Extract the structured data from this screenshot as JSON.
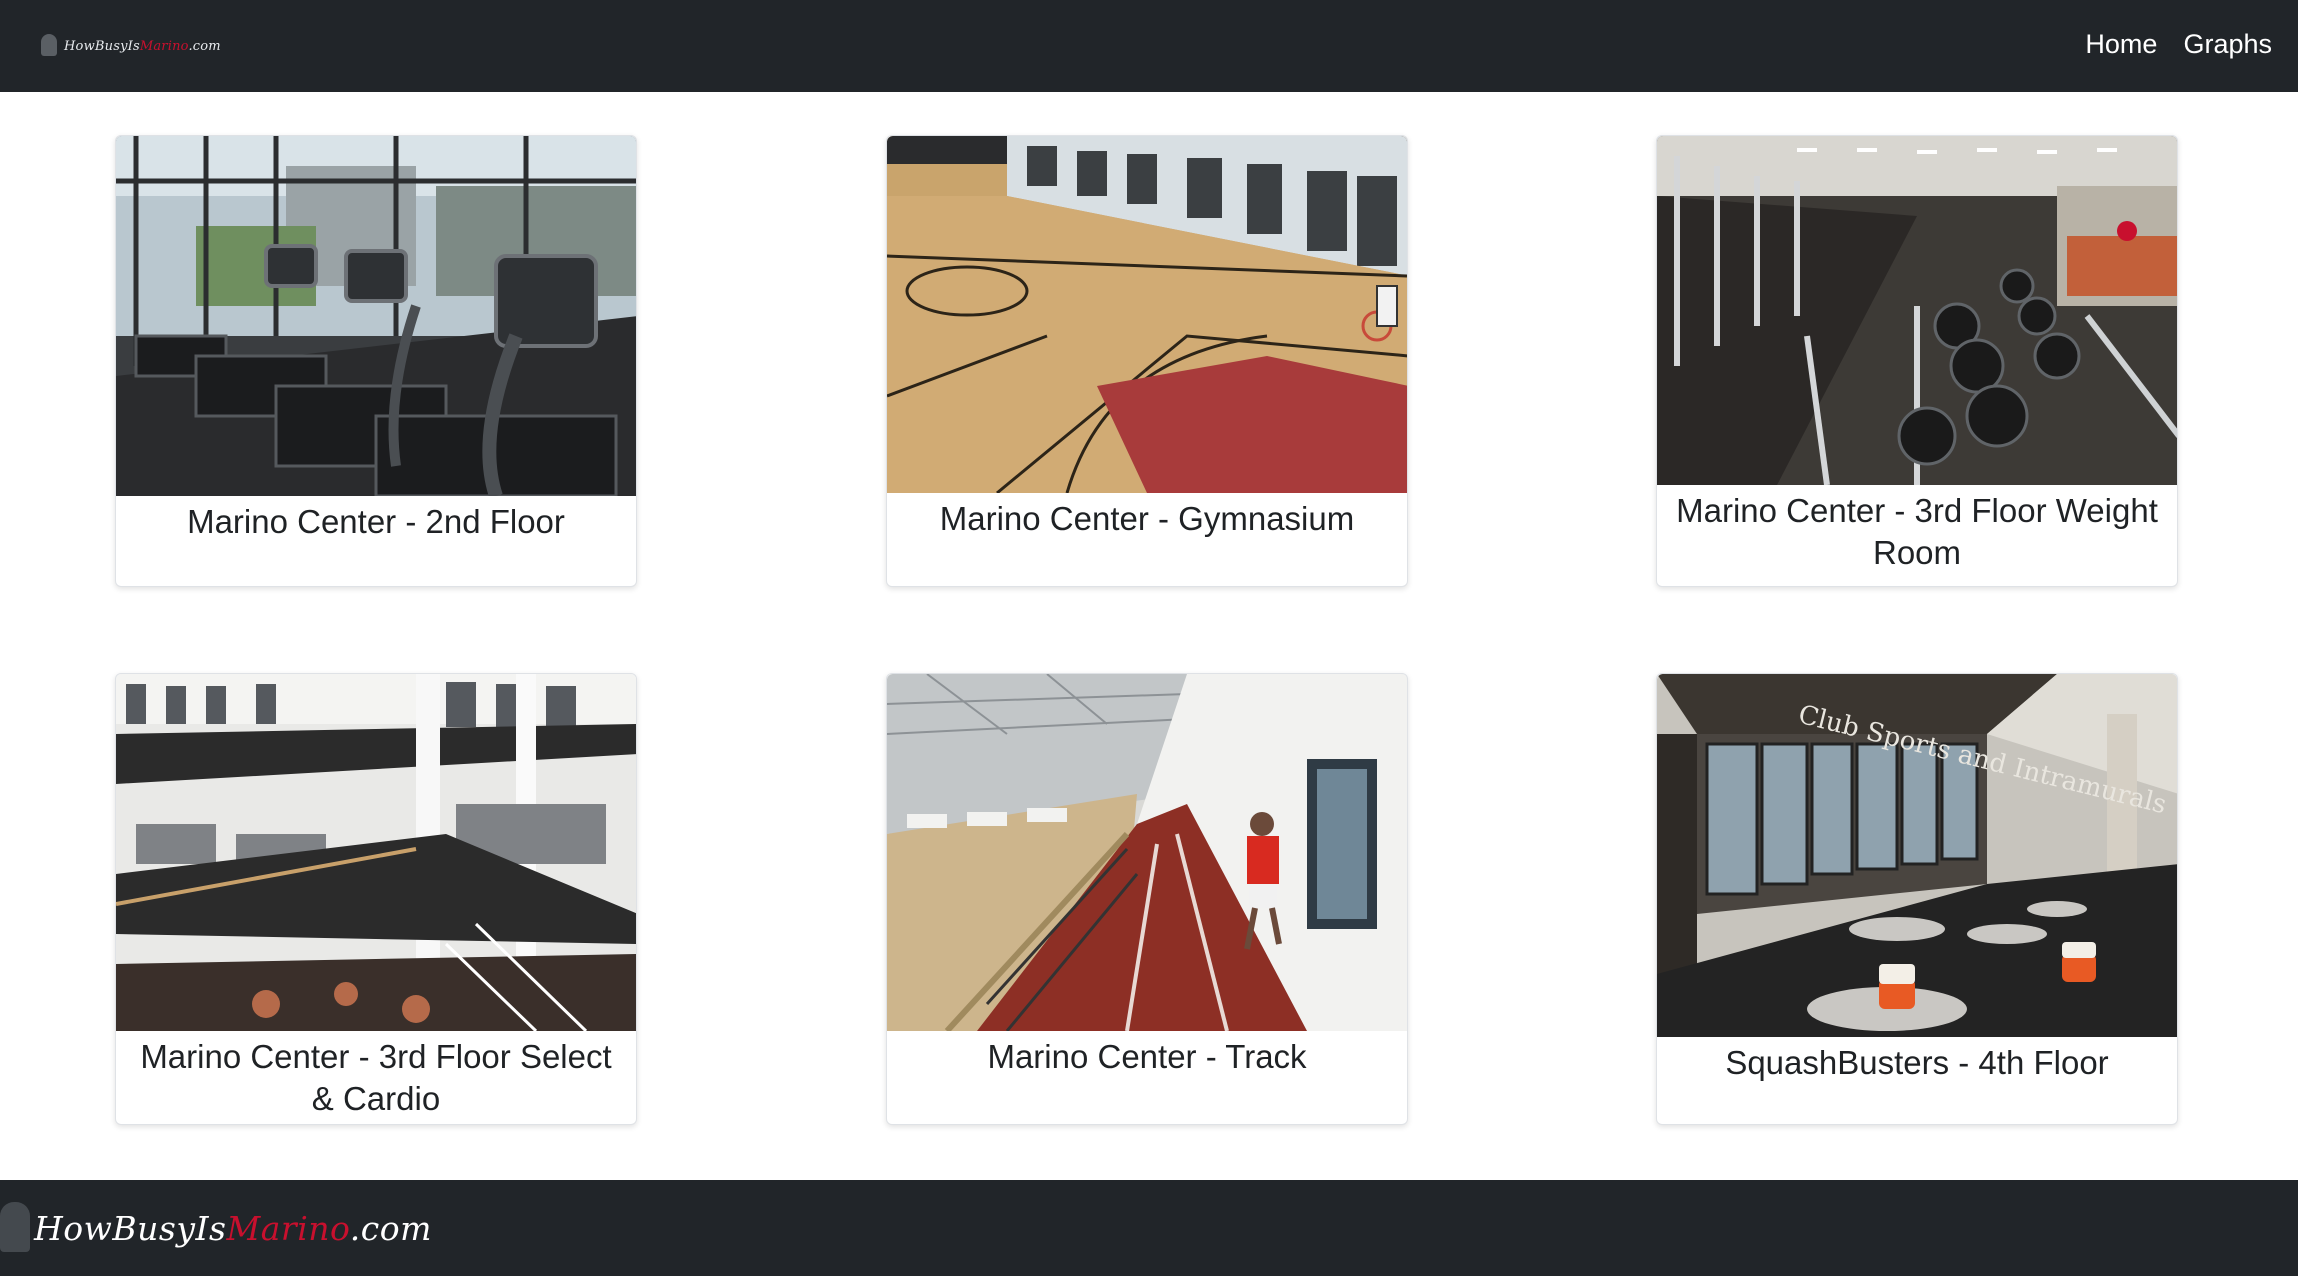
{
  "brand": {
    "name_part1": "HowBusyIs",
    "name_part2": "Marino",
    "name_part3": ".com"
  },
  "nav": {
    "home_label": "Home",
    "graphs_label": "Graphs"
  },
  "cards": [
    {
      "title": "Marino Center - 2nd Floor"
    },
    {
      "title": "Marino Center - Gymnasium"
    },
    {
      "title": "Marino Center - 3rd Floor Weight Room"
    },
    {
      "title": "Marino Center - 3rd Floor Select & Cardio"
    },
    {
      "title": "Marino Center - Track"
    },
    {
      "title": "SquashBusters - 4th Floor"
    }
  ],
  "colors": {
    "navbar": "#212529",
    "accent_red": "#c8102e",
    "card_border": "#dfe2e6"
  }
}
